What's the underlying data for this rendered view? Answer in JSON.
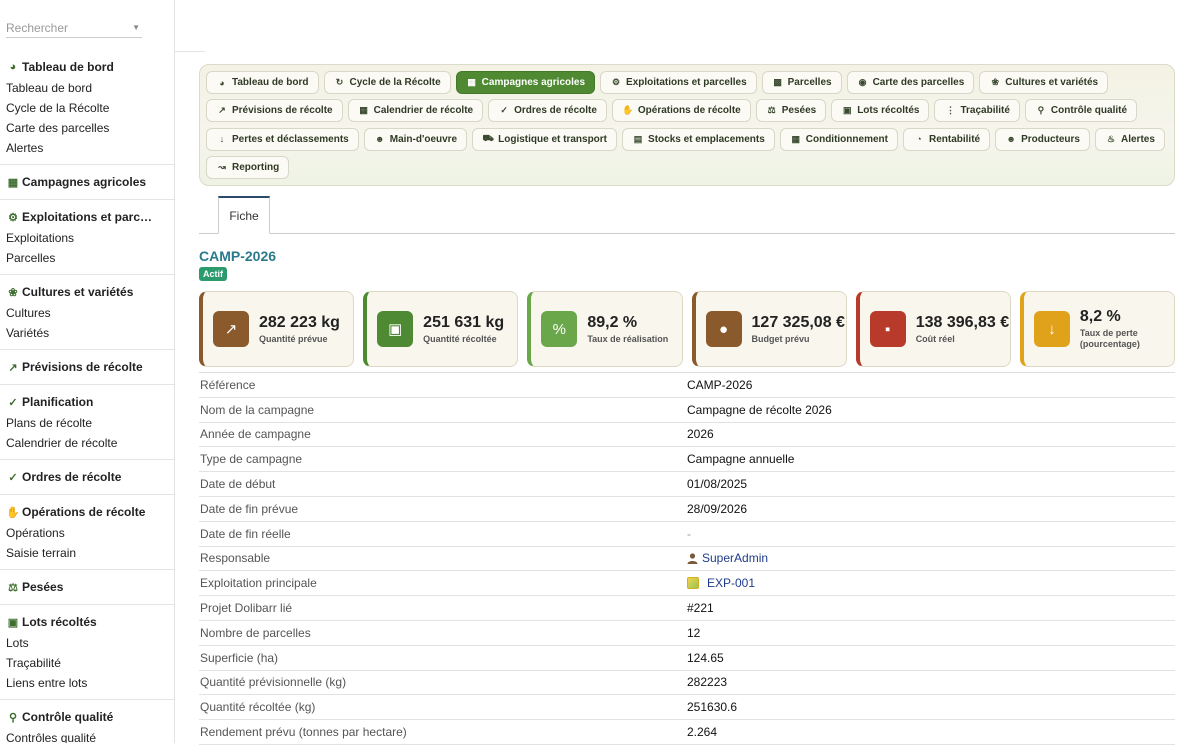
{
  "sidebar": {
    "search_placeholder": "Rechercher",
    "groups": [
      {
        "title": "Tableau de bord",
        "icon": "gauge-icon",
        "items": [
          "Tableau de bord",
          "Cycle de la Récolte",
          "Carte des parcelles",
          "Alertes"
        ]
      },
      {
        "title": "Campagnes agricoles",
        "icon": "calendar-icon",
        "items": []
      },
      {
        "title": "Exploitations et parc…",
        "icon": "tractor-icon",
        "items": [
          "Exploitations",
          "Parcelles"
        ]
      },
      {
        "title": "Cultures et variétés",
        "icon": "seedling-icon",
        "items": [
          "Cultures",
          "Variétés"
        ]
      },
      {
        "title": "Prévisions de récolte",
        "icon": "chart-line-icon",
        "items": []
      },
      {
        "title": "Planification",
        "icon": "clipboard-check-icon",
        "items": [
          "Plans de récolte",
          "Calendrier de récolte"
        ]
      },
      {
        "title": "Ordres de récolte",
        "icon": "clipboard-check-icon",
        "items": []
      },
      {
        "title": "Opérations de récolte",
        "icon": "hand-icon",
        "items": [
          "Opérations",
          "Saisie terrain"
        ]
      },
      {
        "title": "Pesées",
        "icon": "scale-icon",
        "items": []
      },
      {
        "title": "Lots récoltés",
        "icon": "boxes-icon",
        "items": [
          "Lots",
          "Traçabilité",
          "Liens entre lots"
        ]
      },
      {
        "title": "Contrôle qualité",
        "icon": "microscope-icon",
        "items": [
          "Contrôles qualité"
        ]
      }
    ]
  },
  "menu": [
    {
      "label": "Tableau de bord",
      "icon": "gauge-icon"
    },
    {
      "label": "Cycle de la Récolte",
      "icon": "sync-icon"
    },
    {
      "label": "Campagnes agricoles",
      "icon": "calendar-icon",
      "active": true
    },
    {
      "label": "Exploitations et parcelles",
      "icon": "tractor-icon"
    },
    {
      "label": "Parcelles",
      "icon": "map-icon"
    },
    {
      "label": "Carte des parcelles",
      "icon": "map-marked-icon"
    },
    {
      "label": "Cultures et variétés",
      "icon": "seedling-icon"
    },
    {
      "label": "Prévisions de récolte",
      "icon": "chart-line-icon"
    },
    {
      "label": "Calendrier de récolte",
      "icon": "calendar-icon"
    },
    {
      "label": "Ordres de récolte",
      "icon": "clipboard-check-icon"
    },
    {
      "label": "Opérations de récolte",
      "icon": "hand-icon"
    },
    {
      "label": "Pesées",
      "icon": "scale-icon"
    },
    {
      "label": "Lots récoltés",
      "icon": "boxes-icon"
    },
    {
      "label": "Traçabilité",
      "icon": "project-diagram-icon"
    },
    {
      "label": "Contrôle qualité",
      "icon": "microscope-icon"
    },
    {
      "label": "Pertes et déclassements",
      "icon": "arrow-down-icon"
    },
    {
      "label": "Main-d'oeuvre",
      "icon": "users-icon"
    },
    {
      "label": "Logistique et transport",
      "icon": "truck-icon"
    },
    {
      "label": "Stocks et emplacements",
      "icon": "warehouse-icon"
    },
    {
      "label": "Conditionnement",
      "icon": "cubes-icon"
    },
    {
      "label": "Rentabilité",
      "icon": "pie-chart-icon"
    },
    {
      "label": "Producteurs",
      "icon": "user-friends-icon"
    },
    {
      "label": "Alertes",
      "icon": "bell-icon"
    },
    {
      "label": "Reporting",
      "icon": "chart-area-icon"
    }
  ],
  "tab": {
    "label": "Fiche"
  },
  "record": {
    "ref": "CAMP-2026",
    "status": "Actif"
  },
  "cards": [
    {
      "value": "282 223 kg",
      "label": "Quantité prévue",
      "icon": "chart-line-icon",
      "color": "#8a5a2c"
    },
    {
      "value": "251 631 kg",
      "label": "Quantité récoltée",
      "icon": "shopping-bag-icon",
      "color": "#4e8a33"
    },
    {
      "value": "89,2 %",
      "label": "Taux de réalisation",
      "icon": "percent-icon",
      "color": "#6aa64a"
    },
    {
      "value": "127 325,08 €",
      "label": "Budget prévu",
      "icon": "coins-icon",
      "color": "#8a5a2c"
    },
    {
      "value": "138 396,83 €",
      "label": "Coût réel",
      "icon": "money-bill-icon",
      "color": "#b83a2a"
    },
    {
      "value": "8,2 %",
      "label": "Taux de perte (pourcentage)",
      "icon": "arrow-down-icon",
      "color": "#e0a21a"
    }
  ],
  "fields": [
    {
      "label": "Référence",
      "value": "CAMP-2026"
    },
    {
      "label": "Nom de la campagne",
      "value": "Campagne de récolte 2026"
    },
    {
      "label": "Année de campagne",
      "value": "2026"
    },
    {
      "label": "Type de campagne",
      "value": "Campagne annuelle"
    },
    {
      "label": "Date de début",
      "value": "01/08/2025"
    },
    {
      "label": "Date de fin prévue",
      "value": "28/09/2026"
    },
    {
      "label": "Date de fin réelle",
      "value": "-"
    },
    {
      "label": "Responsable",
      "value": "SuperAdmin"
    },
    {
      "label": "Exploitation principale",
      "value": "EXP-001"
    },
    {
      "label": "Projet Dolibarr lié",
      "value": "#221"
    },
    {
      "label": "Nombre de parcelles",
      "value": "12"
    },
    {
      "label": "Superficie (ha)",
      "value": "124.65"
    },
    {
      "label": "Quantité prévisionnelle (kg)",
      "value": "282223"
    },
    {
      "label": "Quantité récoltée (kg)",
      "value": "251630.6"
    },
    {
      "label": "Rendement prévu (tonnes par hectare)",
      "value": "2.264"
    }
  ]
}
